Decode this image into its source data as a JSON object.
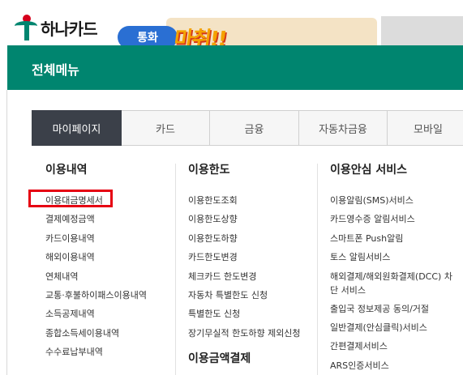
{
  "header": {
    "brand_name": "하나카드",
    "banner_tag": "통화",
    "banner_promo": "마취!!"
  },
  "panel": {
    "title": "전체메뉴"
  },
  "tabs": [
    {
      "label": "마이페이지",
      "active": true
    },
    {
      "label": "카드",
      "active": false
    },
    {
      "label": "금융",
      "active": false
    },
    {
      "label": "자동차금융",
      "active": false
    },
    {
      "label": "모바일",
      "active": false
    }
  ],
  "columns": [
    {
      "heading": "이용내역",
      "items": [
        "이용대금명세서",
        "결제예정금액",
        "카드이용내역",
        "해외이용내역",
        "연체내역",
        "교통·후불하이패스이용내역",
        "소득공제내역",
        "종합소득세이용내역",
        "수수료납부내역"
      ]
    },
    {
      "heading": "이용한도",
      "items": [
        "이용한도조회",
        "이용한도상향",
        "이용한도하향",
        "카드한도변경",
        "체크카드 한도변경",
        "자동차 특별한도 신청",
        "특별한도 신청",
        "장기무실적 한도하향 제외신청"
      ],
      "subheading": "이용금액결제"
    },
    {
      "heading": "이용안심 서비스",
      "items": [
        "이용알림(SMS)서비스",
        "카드영수증 알림서비스",
        "스마트폰 Push알림",
        "토스 알림서비스",
        "해외결제/해외원화결제(DCC) 차단 서비스",
        "출입국 정보제공 동의/거절",
        "일반결제(안심클릭)서비스",
        "간편결제서비스",
        "ARS인증서비스"
      ]
    }
  ],
  "highlight_color": "#e60012",
  "accent_color": "#00856f"
}
